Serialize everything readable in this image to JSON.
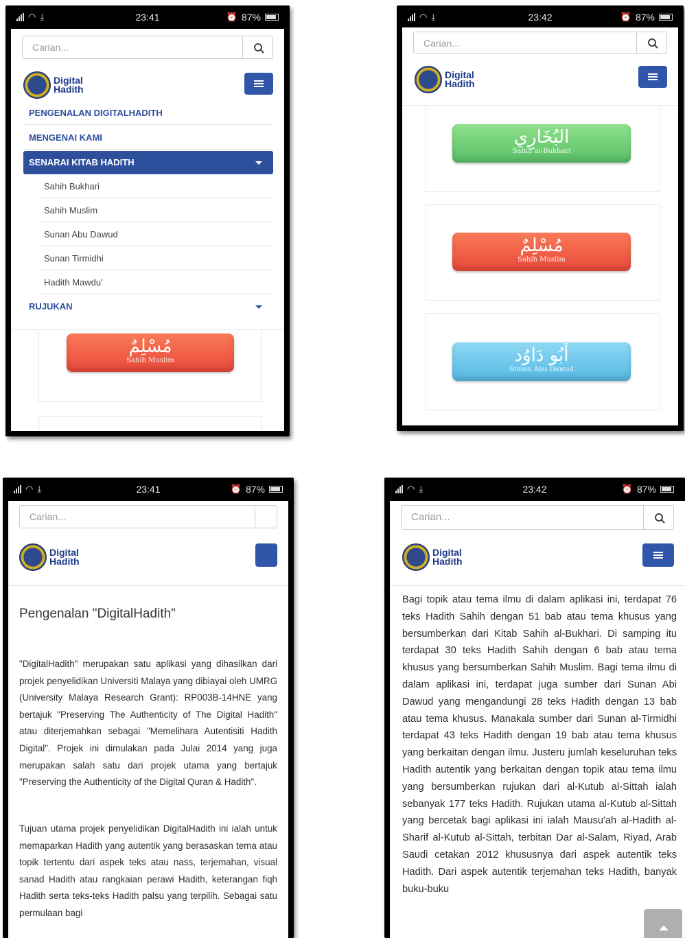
{
  "status": {
    "battery": "87%"
  },
  "search": {
    "placeholder": "Carian..."
  },
  "logo": {
    "line1": "Digital",
    "line2": "Hadith"
  },
  "phone1": {
    "time": "23:41",
    "nav": [
      {
        "label": "PENGENALAN DIGITALHADITH"
      },
      {
        "label": "MENGENAI KAMI"
      },
      {
        "label": "SENARAI KITAB HADITH"
      },
      {
        "label": "RUJUKAN"
      }
    ],
    "submenu": [
      "Sahih Bukhari",
      "Sahih Muslim",
      "Sunan Abu Dawud",
      "Sunan Tirmidhi",
      "Hadith Mawdu'"
    ],
    "book": {
      "arabic": "مُسْلِمٌ",
      "latin": "Sahih Muslim"
    }
  },
  "phone2": {
    "time": "23:42",
    "books": [
      {
        "arabic": "البُخَارِي",
        "latin": "Sahih al-Bukhari"
      },
      {
        "arabic": "مُسْلِمٌ",
        "latin": "Sahih Muslim"
      },
      {
        "arabic": "أبُو دَاوُد",
        "latin": "Sunan Abu Dawud"
      }
    ]
  },
  "phone3": {
    "time": "23:41",
    "title": "Pengenalan \"DigitalHadith\"",
    "para1": "\"DigitalHadith\" merupakan satu aplikasi yang dihasilkan dari projek penyelidikan Universiti Malaya yang dibiayai oleh UMRG (University Malaya Research Grant): RP003B-14HNE yang bertajuk \"Preserving The Authenticity of The Digital Hadith\" atau diterjemahkan sebagai \"Memelihara Autentisiti Hadith Digital\". Projek ini dimulakan pada Julai 2014 yang juga merupakan salah satu dari projek utama yang bertajuk \"Preserving the Authenticity of the Digital Quran & Hadith\".",
    "para2": "Tujuan utama projek penyelidikan DigitalHadith ini ialah untuk memaparkan Hadith yang autentik yang berasaskan tema atau topik tertentu dari aspek teks atau nass, terjemahan, visual sanad Hadith atau rangkaian perawi Hadith, keterangan fiqh Hadith serta teks-teks Hadith palsu yang terpilih. Sebagai satu permulaan bagi"
  },
  "phone4": {
    "time": "23:42",
    "para": "Bagi topik atau tema ilmu di dalam aplikasi ini, terdapat 76 teks Hadith Sahih dengan 51 bab atau tema khusus yang bersumberkan dari Kitab Sahih al-Bukhari. Di samping itu terdapat 30 teks Hadith Sahih dengan 6 bab atau tema khusus yang bersumberkan Sahih Muslim. Bagi tema ilmu di dalam aplikasi ini, terdapat juga sumber dari Sunan Abi Dawud yang mengandungi 28 teks Hadith dengan 13 bab atau tema khusus. Manakala sumber dari Sunan al-Tirmidhi terdapat 43 teks Hadith dengan 19 bab atau tema khusus yang berkaitan dengan ilmu. Justeru jumlah keseluruhan teks Hadith autentik yang berkaitan dengan topik atau tema ilmu yang bersumberkan rujukan dari al-Kutub al-Sittah ialah sebanyak 177 teks Hadith. Rujukan utama al-Kutub al-Sittah yang bercetak bagi aplikasi ini ialah Mausu'ah al-Hadith al-Sharif al-Kutub al-Sittah, terbitan Dar al-Salam, Riyad, Arab Saudi cetakan 2012 khususnya dari aspek autentik teks Hadith. Dari aspek autentik terjemahan teks Hadith, banyak buku-buku"
  }
}
